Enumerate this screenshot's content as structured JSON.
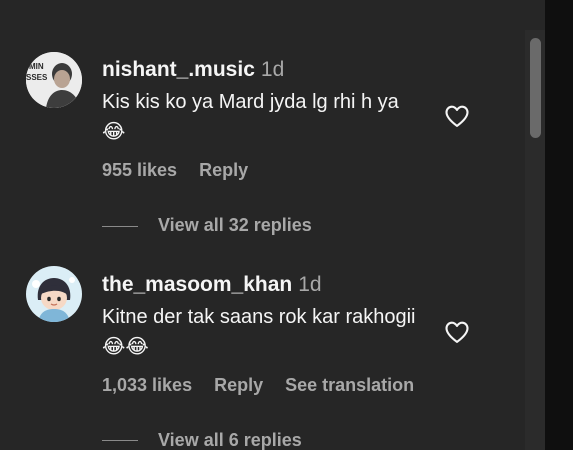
{
  "comments": [
    {
      "username": "nishant_.music",
      "time": "1d",
      "text": "Kis kis ko ya Mard jyda lg rhi h ya 😂",
      "avatar_text": "MIN SSES",
      "likes": "955 likes",
      "reply": "Reply",
      "view_replies": "View all 32 replies"
    },
    {
      "username": "the_masoom_khan",
      "time": "1d",
      "text": "Kitne der tak saans rok kar rakhogii😂😂",
      "likes": "1,033 likes",
      "reply": "Reply",
      "translation": "See translation",
      "view_replies": "View all 6 replies"
    }
  ],
  "colors": {
    "background": "#262626",
    "text_primary": "#f5f5f5",
    "text_secondary": "#a8a8a8",
    "side_strip": "#0f0f0f"
  },
  "icons": {
    "like": "heart-icon"
  }
}
